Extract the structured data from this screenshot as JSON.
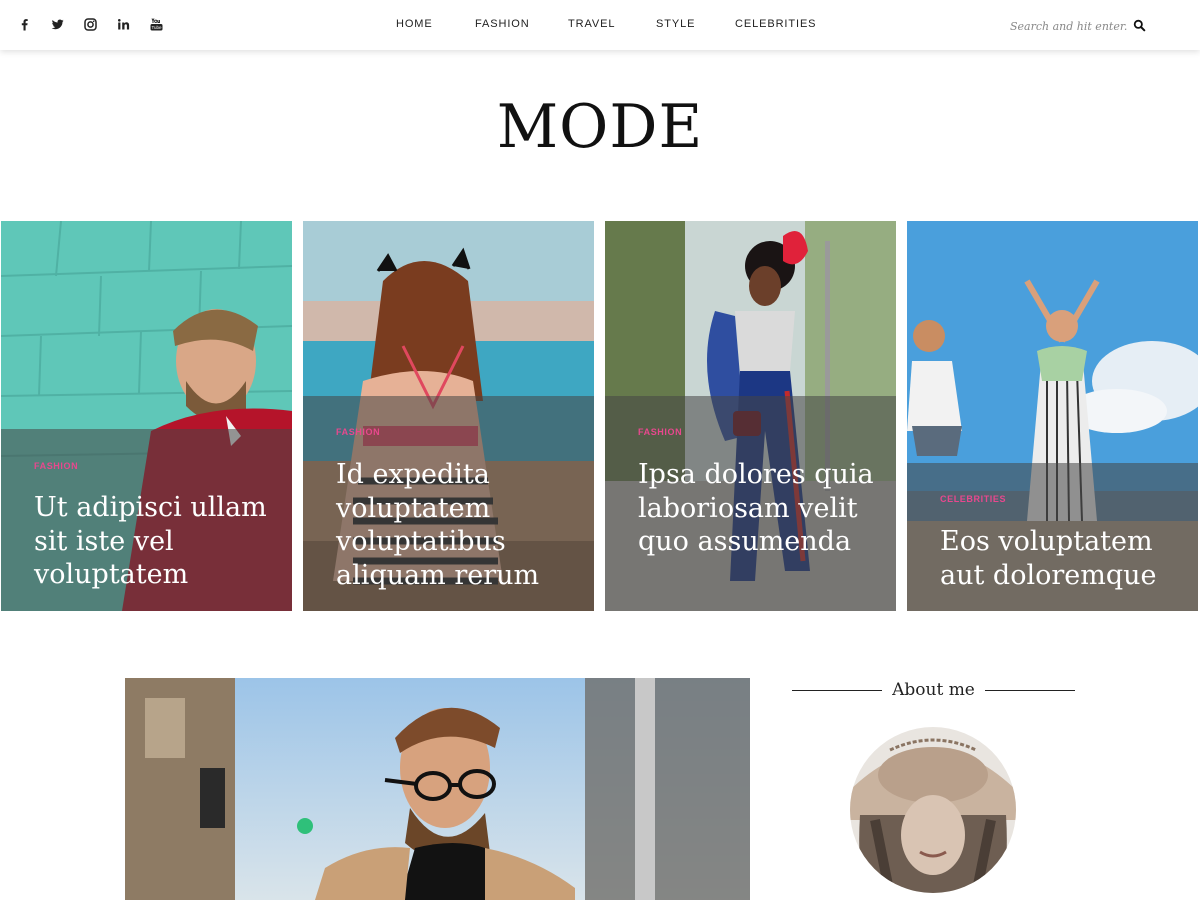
{
  "social": [
    {
      "name": "facebook-icon"
    },
    {
      "name": "twitter-icon"
    },
    {
      "name": "instagram-icon"
    },
    {
      "name": "linkedin-icon"
    },
    {
      "name": "youtube-icon"
    }
  ],
  "nav": {
    "items": [
      "HOME",
      "FASHION",
      "TRAVEL",
      "STYLE",
      "CELEBRITIES"
    ]
  },
  "search": {
    "placeholder": "Search and hit enter..."
  },
  "site": {
    "logo": "MODE"
  },
  "featured": [
    {
      "category": "FASHION",
      "title": "Ut adipisci ullam sit iste vel voluptatem"
    },
    {
      "category": "FASHION",
      "title": "Id expedita voluptatem voluptatibus aliquam rerum"
    },
    {
      "category": "FASHION",
      "title": "Ipsa dolores quia laboriosam velit quo assumenda"
    },
    {
      "category": "CELEBRITIES",
      "title": "Eos voluptatem aut doloremque"
    }
  ],
  "sidebar": {
    "about_title": "About me"
  },
  "colors": {
    "accent": "#e8488e",
    "overlay": "#464646"
  }
}
